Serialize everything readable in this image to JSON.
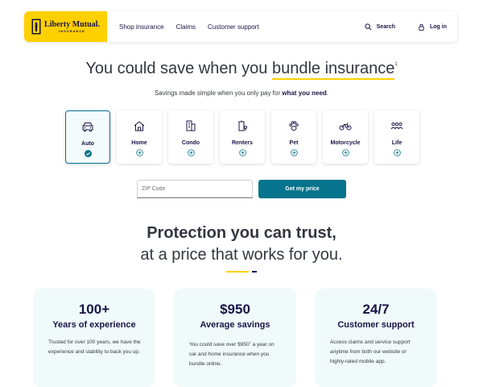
{
  "brand": {
    "name": "Liberty Mutual.",
    "sub": "INSURANCE",
    "accent": "#ffd000",
    "navy": "#1a1446",
    "teal": "#06748c"
  },
  "nav": {
    "items": [
      "Shop insurance",
      "Claims",
      "Customer support"
    ],
    "search": "Search",
    "login": "Log in"
  },
  "hero": {
    "title_pre": "You could save when you ",
    "title_hl": "bundle insurance",
    "title_sup": "1",
    "sub_pre": "Savings made simple when you only pay for ",
    "sub_bold": "what you need",
    "sub_end": "."
  },
  "products": [
    {
      "label": "Auto",
      "icon": "car-icon",
      "selected": true
    },
    {
      "label": "Home",
      "icon": "home-icon",
      "selected": false
    },
    {
      "label": "Condo",
      "icon": "condo-icon",
      "selected": false
    },
    {
      "label": "Renters",
      "icon": "renters-icon",
      "selected": false
    },
    {
      "label": "Pet",
      "icon": "paw-icon",
      "selected": false
    },
    {
      "label": "Motorcycle",
      "icon": "motorcycle-icon",
      "selected": false
    },
    {
      "label": "Life",
      "icon": "people-icon",
      "selected": false
    }
  ],
  "quote": {
    "zip_placeholder": "ZIP Code",
    "zip_value": "",
    "button": "Get my price"
  },
  "protection": {
    "line1": "Protection you can trust,",
    "line2": "at a price that works for you."
  },
  "stats": [
    {
      "big": "100+",
      "title": "Years of experience",
      "body": "Trusted for over 100 years, we have the experience and stability to back you up."
    },
    {
      "big": "$950",
      "title": "Average savings",
      "body_pre": "You could save over $950",
      "body_sup": "1",
      "body_post": " a year on car and home insurance when you bundle online."
    },
    {
      "big": "24/7",
      "title": "Customer support",
      "body": "Access claims and service support anytime from both our website or highly-rated mobile app."
    }
  ]
}
